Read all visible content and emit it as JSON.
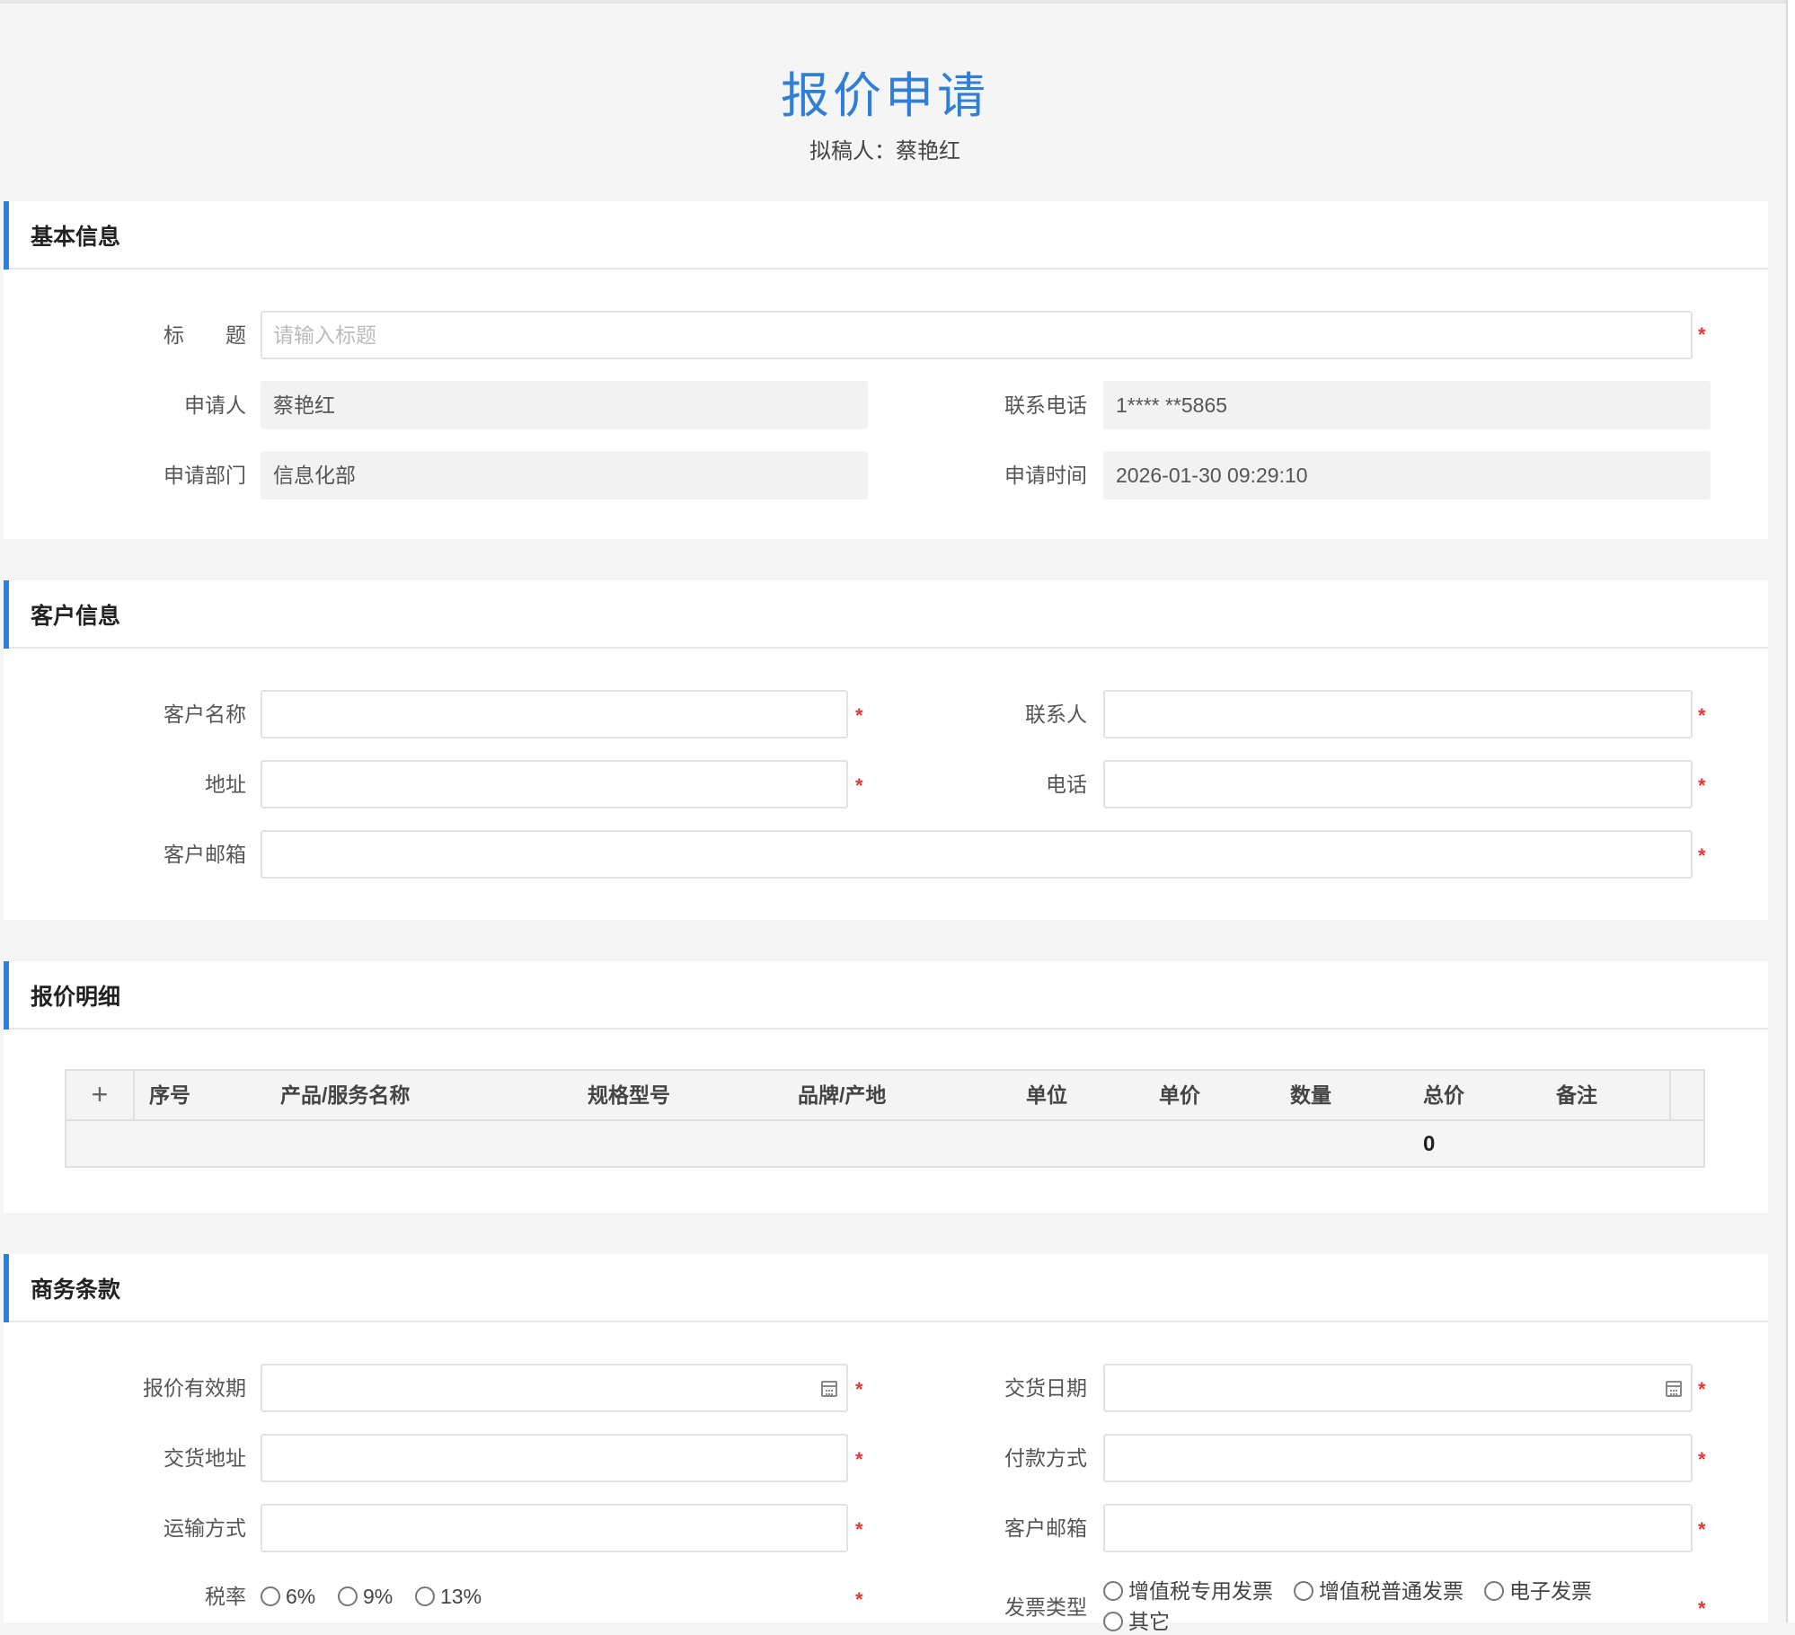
{
  "header": {
    "title": "报价申请",
    "drafter": "拟稿人：蔡艳红"
  },
  "basic": {
    "section_title": "基本信息",
    "title_label": "标　　题",
    "title_placeholder": "请输入标题",
    "applicant_label": "申请人",
    "applicant_value": "蔡艳红",
    "phone_label": "联系电话",
    "phone_value": "1**** **5865",
    "dept_label": "申请部门",
    "dept_value": "信息化部",
    "time_label": "申请时间",
    "time_value": "2026-01-30 09:29:10"
  },
  "customer": {
    "section_title": "客户信息",
    "name_label": "客户名称",
    "contact_label": "联系人",
    "address_label": "地址",
    "phone_label": "电话",
    "email_label": "客户邮箱"
  },
  "detail": {
    "section_title": "报价明细",
    "add_symbol": "+",
    "columns": [
      "序号",
      "产品/服务名称",
      "规格型号",
      "品牌/产地",
      "单位",
      "单价",
      "数量",
      "总价",
      "备注"
    ],
    "total": "0"
  },
  "terms": {
    "section_title": "商务条款",
    "validity_label": "报价有效期",
    "delivery_date_label": "交货日期",
    "delivery_addr_label": "交货地址",
    "payment_label": "付款方式",
    "transport_label": "运输方式",
    "email_label": "客户邮箱",
    "tax_label": "税率",
    "tax_options": [
      "6%",
      "9%",
      "13%"
    ],
    "invoice_label": "发票类型",
    "invoice_options": [
      "增值税专用发票",
      "增值税普通发票",
      "电子发票",
      "其它"
    ]
  },
  "required_mark": "*"
}
